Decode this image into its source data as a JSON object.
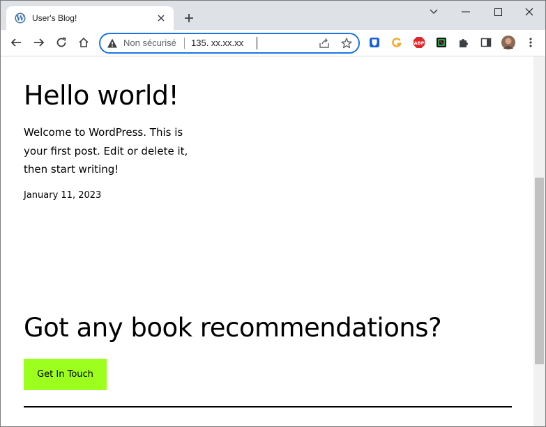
{
  "tab": {
    "title": "User's Blog!",
    "favicon": "wordpress-icon"
  },
  "address_bar": {
    "security_label": "Non sécurisé",
    "url": "135. xx.xx.xx"
  },
  "colors": {
    "omnibox_focus": "#1a73e8",
    "cta_background": "#9cff1e",
    "tabstrip": "#dee1e6"
  },
  "extensions": [
    "bitwarden-icon",
    "grammarly-icon",
    "adblock-plus-icon",
    "dark-reader-icon",
    "extensions-puzzle-icon",
    "side-panel-icon",
    "profile-avatar"
  ],
  "post": {
    "title": "Hello world!",
    "body": "Welcome to WordPress. This is your first post. Edit or delete it, then start writing!",
    "date": "January 11, 2023"
  },
  "cta": {
    "heading": "Got any book recommendations?",
    "button_label": "Get In Touch"
  }
}
